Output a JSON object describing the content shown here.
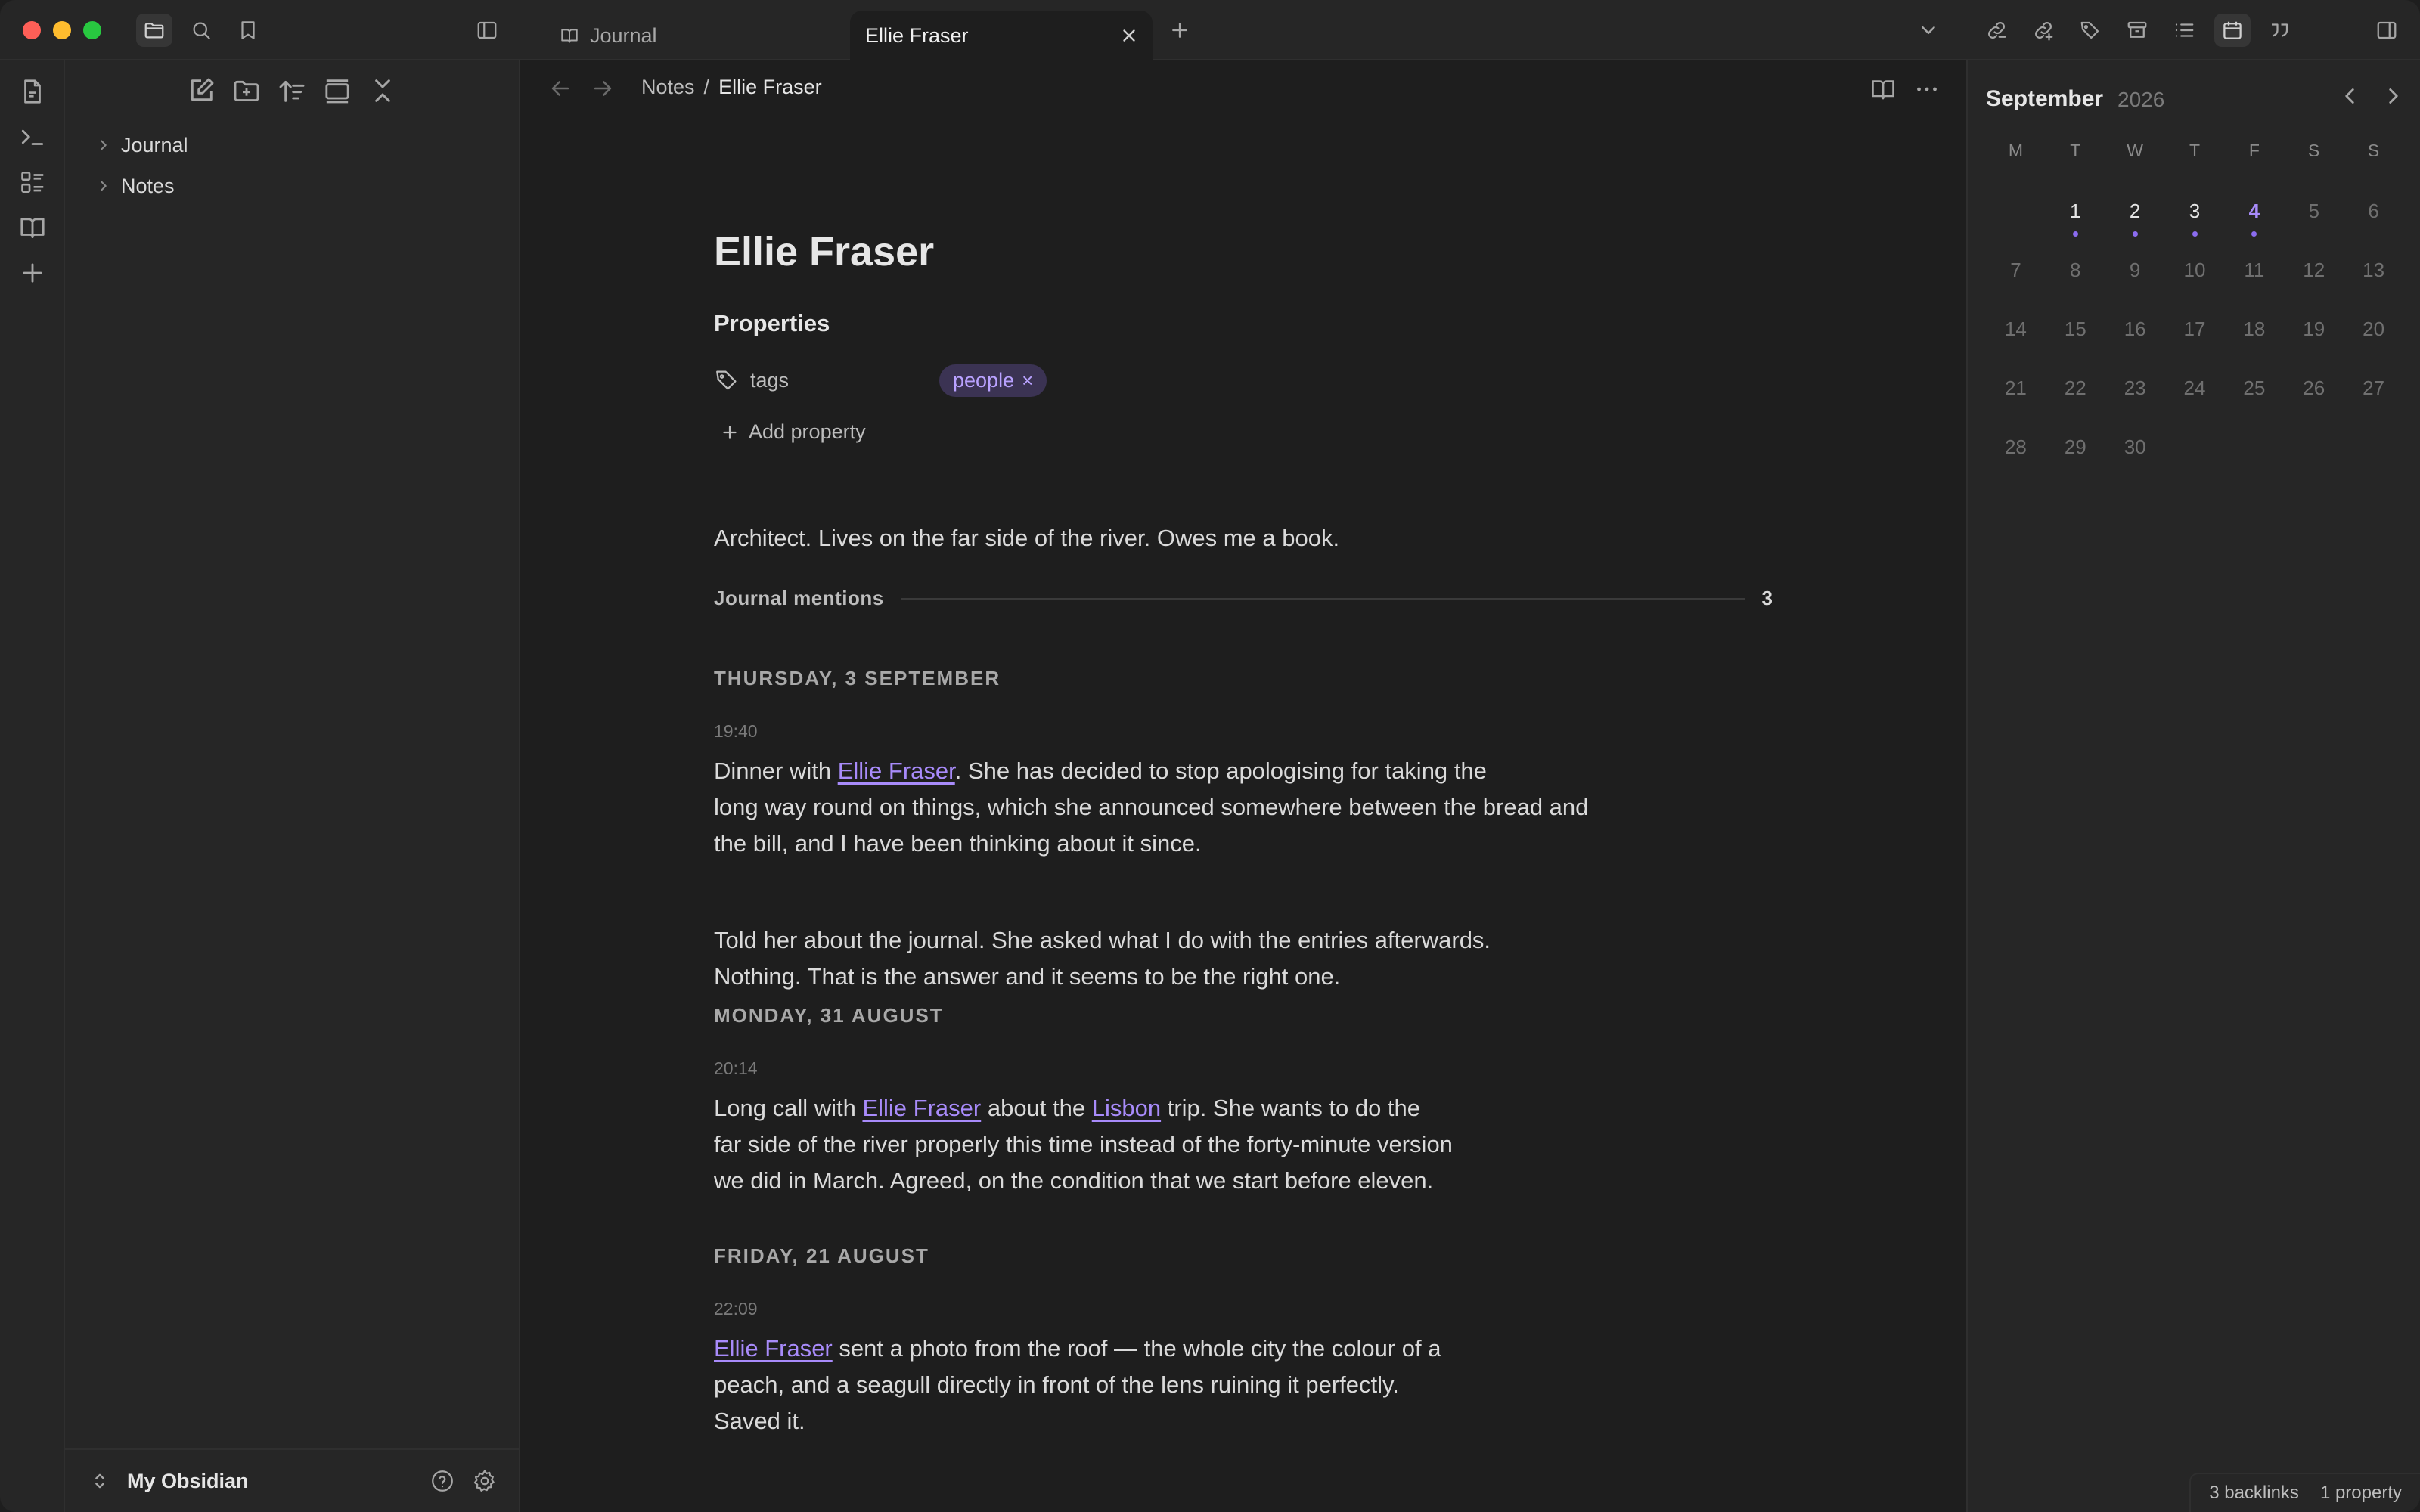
{
  "window": {
    "tabs": [
      {
        "label": "Journal",
        "active": false
      },
      {
        "label": "Ellie Fraser",
        "active": true
      }
    ]
  },
  "sidebar": {
    "tree": [
      {
        "label": "Journal"
      },
      {
        "label": "Notes"
      }
    ],
    "vault_name": "My Obsidian"
  },
  "breadcrumb": {
    "parent": "Notes",
    "separator": "/",
    "current": "Ellie Fraser"
  },
  "note": {
    "title": "Ellie Fraser",
    "properties_heading": "Properties",
    "property": {
      "key": "tags",
      "value": "people"
    },
    "add_property": "Add property",
    "summary": "Architect. Lives on the far side of the river. Owes me a book.",
    "mentions_heading": "Journal mentions",
    "mentions_count": "3",
    "entries": [
      {
        "day": "THURSDAY, 3 SEPTEMBER",
        "time": "19:40",
        "p1_pre": "Dinner with ",
        "p1_link": "Ellie Fraser",
        "p1_line1_post": ". She has decided to stop apologising for taking the",
        "p1_line2": "long way round on things, which she announced somewhere between the bread and",
        "p1_line3": "the bill, and I have been thinking about it since.",
        "p2_line1": "Told her about the journal. She asked what I do with the entries afterwards.",
        "p2_line2": "Nothing. That is the answer and it seems to be the right one."
      },
      {
        "day": "MONDAY, 31 AUGUST",
        "time": "20:14",
        "p1_pre": "Long call with ",
        "p1_link": "Ellie Fraser",
        "p1_mid": " about the ",
        "p1_link2": "Lisbon",
        "p1_line1_post": " trip. She wants to do the",
        "p1_line2": "far side of the river properly this time instead of the forty-minute version",
        "p1_line3": "we did in March. Agreed, on the condition that we start before eleven."
      },
      {
        "day": "FRIDAY, 21 AUGUST",
        "time": "22:09",
        "p1_link": "Ellie Fraser",
        "p1_line1_post": " sent a photo from the roof — the whole city the colour of a",
        "p1_line2": "peach, and a seagull directly in front of the lens ruining it perfectly.",
        "p1_line3": "Saved it."
      }
    ]
  },
  "calendar": {
    "month": "September",
    "year": "2026",
    "weekdays": [
      "M",
      "T",
      "W",
      "T",
      "F",
      "S",
      "S"
    ],
    "weeks": [
      [
        "",
        "1",
        "2",
        "3",
        "4",
        "5",
        "6"
      ],
      [
        "7",
        "8",
        "9",
        "10",
        "11",
        "12",
        "13"
      ],
      [
        "14",
        "15",
        "16",
        "17",
        "18",
        "19",
        "20"
      ],
      [
        "21",
        "22",
        "23",
        "24",
        "25",
        "26",
        "27"
      ],
      [
        "28",
        "29",
        "30",
        "",
        "",
        "",
        ""
      ]
    ],
    "days_with_entries": [
      "1",
      "2",
      "3",
      "4"
    ],
    "today": "4"
  },
  "status_bar": {
    "backlinks": "3 backlinks",
    "properties": "1 property"
  },
  "colors": {
    "accent": "#a88bfa",
    "background": "#1e1e1e",
    "panel": "#262626"
  }
}
